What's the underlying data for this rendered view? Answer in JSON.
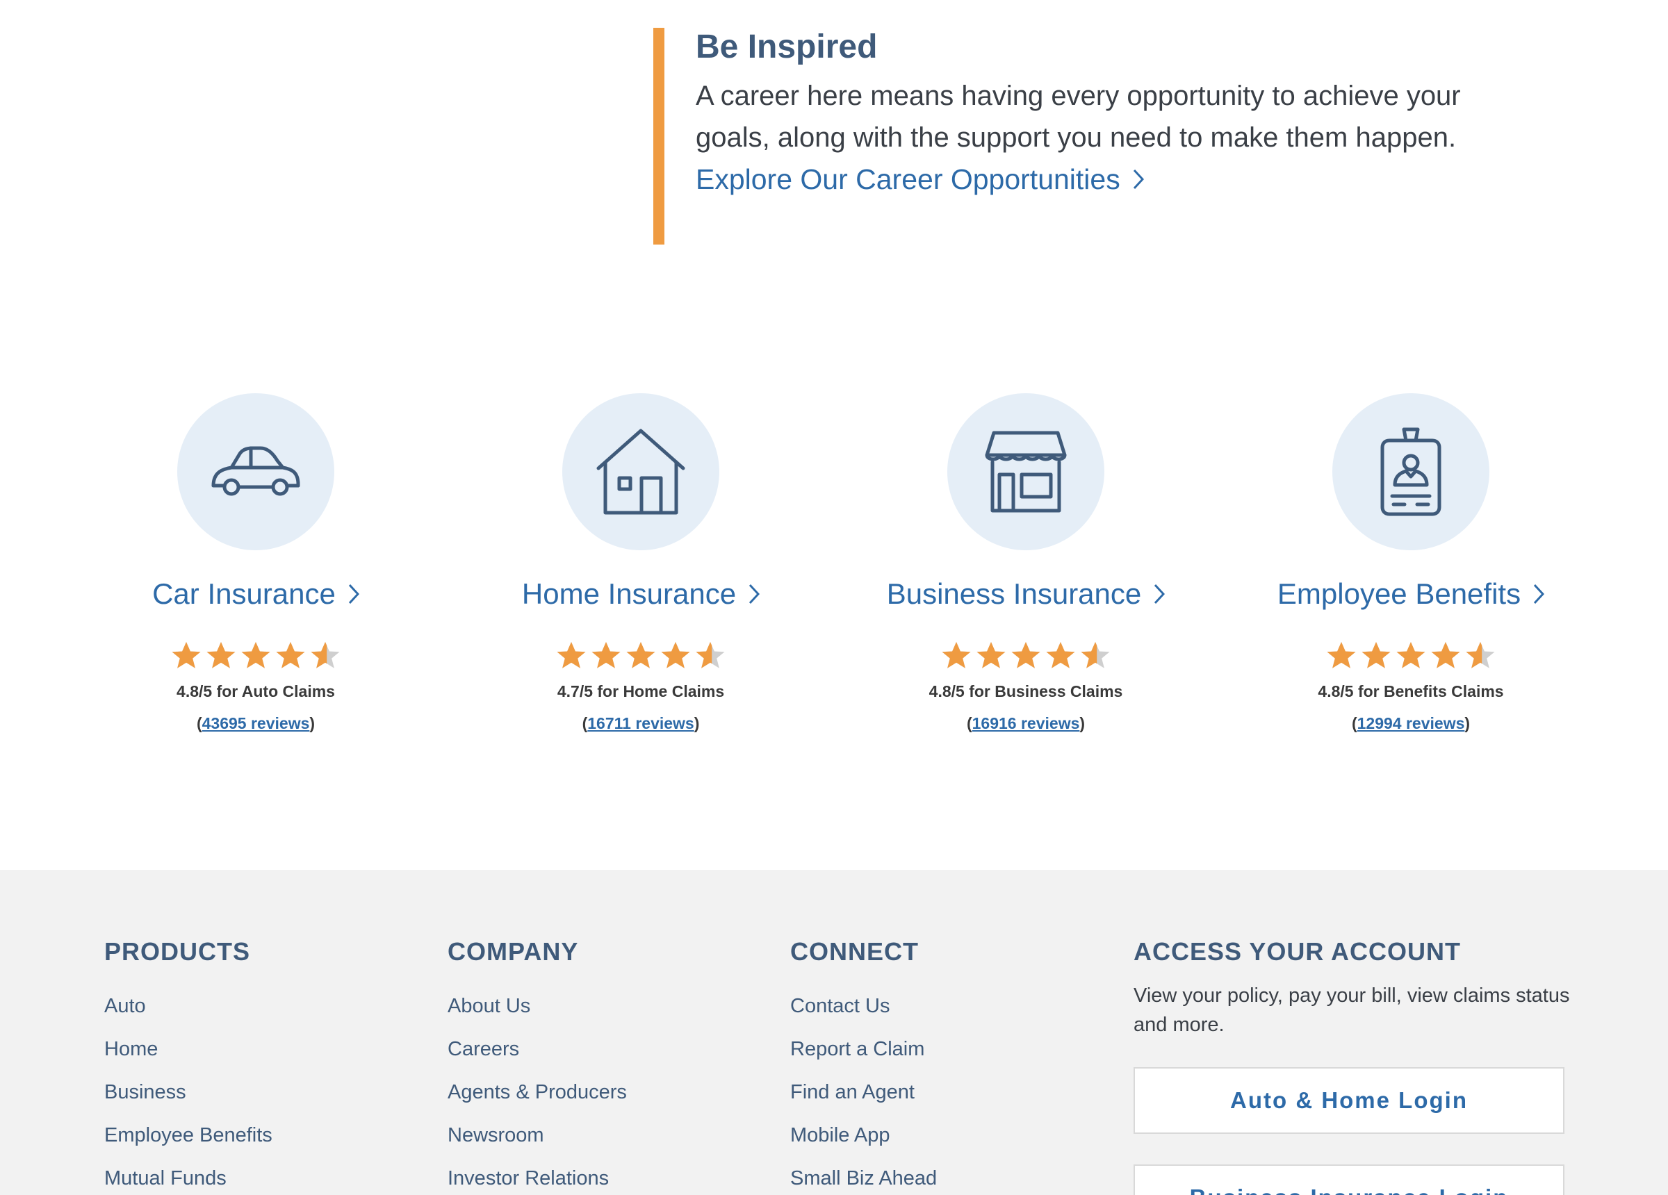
{
  "inspire": {
    "heading": "Be Inspired",
    "body": "A career here means having every opportunity to achieve your goals, along with the support you need to make them happen.",
    "cta": "Explore Our Career Opportunities"
  },
  "products": [
    {
      "title": "Car Insurance",
      "icon": "car-icon",
      "rating": 4.8,
      "rating_text": "4.8/5 for Auto Claims",
      "review_count": "43695 reviews"
    },
    {
      "title": "Home Insurance",
      "icon": "house-icon",
      "rating": 4.7,
      "rating_text": "4.7/5 for Home Claims",
      "review_count": "16711 reviews"
    },
    {
      "title": "Business Insurance",
      "icon": "storefront-icon",
      "rating": 4.8,
      "rating_text": "4.8/5 for Business Claims",
      "review_count": "16916 reviews"
    },
    {
      "title": "Employee Benefits",
      "icon": "id-badge-icon",
      "rating": 4.8,
      "rating_text": "4.8/5 for Benefits Claims",
      "review_count": "12994 reviews"
    }
  ],
  "footer": {
    "products": {
      "heading": "PRODUCTS",
      "items": [
        "Auto",
        "Home",
        "Business",
        "Employee Benefits",
        "Mutual Funds"
      ]
    },
    "company": {
      "heading": "COMPANY",
      "items": [
        "About Us",
        "Careers",
        "Agents & Producers",
        "Newsroom",
        "Investor Relations"
      ]
    },
    "connect": {
      "heading": "CONNECT",
      "items": [
        "Contact Us",
        "Report a Claim",
        "Find an Agent",
        "Mobile App",
        "Small Biz Ahead"
      ]
    },
    "account": {
      "heading": "ACCESS YOUR ACCOUNT",
      "description": "View your policy, pay your bill, view claims status and more.",
      "auto_home_login": "Auto & Home Login",
      "business_login": "Business Insurance Login"
    }
  },
  "colors": {
    "accent_orange": "#ef9b41",
    "link_blue": "#2d6aa8",
    "heading_navy": "#3f5a7a",
    "icon_circle": "#e5eef7",
    "footer_bg": "#f2f2f2"
  }
}
